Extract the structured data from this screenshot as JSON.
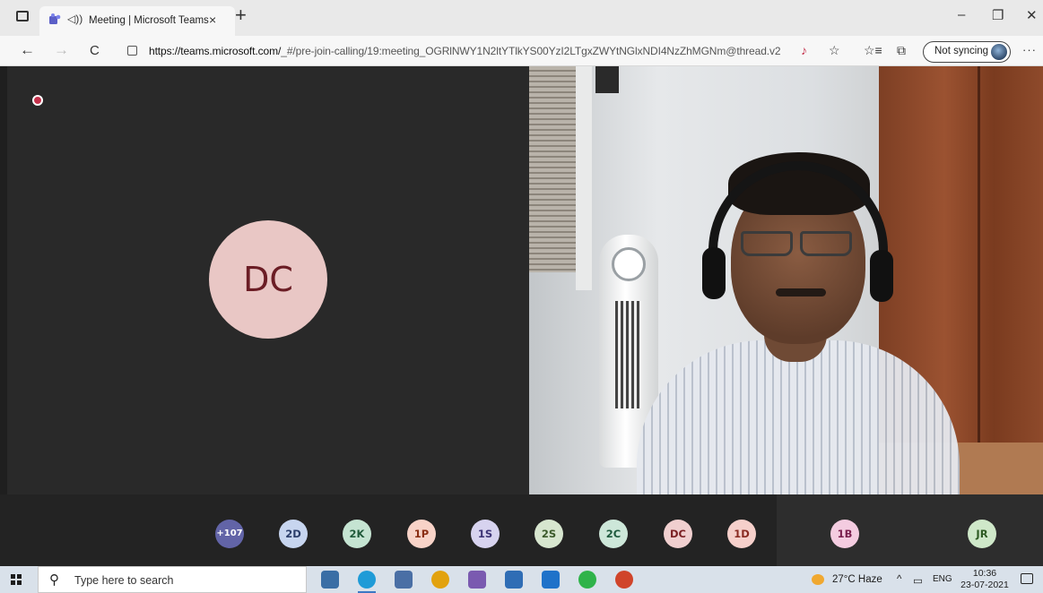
{
  "browser": {
    "tab_title": "Meeting | Microsoft Teams",
    "tab_audio_icon": "speaker-icon",
    "tab_close": "×",
    "new_tab": "+",
    "window_min": "–",
    "window_restore": "❐",
    "window_close": "✕",
    "back": "←",
    "forward": "→",
    "refresh": "C",
    "url_domain": "https://teams.microsoft.com/",
    "url_path": "_#/pre-join-calling/19:meeting_OGRlNWY1N2ltYTlkYS00YzI2LTgxZWYtNGlxNDI4NzZhMGNm@thread.v2",
    "sync_label": "Not syncing",
    "more": "···",
    "accent_color": "#0f6cbd"
  },
  "meeting": {
    "main_participant_initials": "DC",
    "main_avatar_color": "#e9c7c5",
    "recording_color": "#c4314b",
    "participants": [
      {
        "initials": "+107",
        "bg": "#6264a7",
        "fg": "#ffffff"
      },
      {
        "initials": "2D",
        "bg": "#c7d5ef",
        "fg": "#2b3e6b"
      },
      {
        "initials": "2K",
        "bg": "#c5e4d2",
        "fg": "#1f5a3a"
      },
      {
        "initials": "1P",
        "bg": "#f8d3c8",
        "fg": "#8a2d12"
      },
      {
        "initials": "1S",
        "bg": "#d7d3ef",
        "fg": "#3c3375"
      },
      {
        "initials": "2S",
        "bg": "#d7e6cf",
        "fg": "#3b5a2a"
      },
      {
        "initials": "2C",
        "bg": "#cde7d9",
        "fg": "#1e5a3d"
      },
      {
        "initials": "DC",
        "bg": "#f0cfcf",
        "fg": "#7a1f22"
      },
      {
        "initials": "1D",
        "bg": "#f6d0cb",
        "fg": "#8a2b22"
      },
      {
        "initials": "1B",
        "bg": "#f4cce0",
        "fg": "#7a1f4e"
      },
      {
        "initials": "JR",
        "bg": "#cfe8c9",
        "fg": "#2d5a22"
      }
    ]
  },
  "taskbar": {
    "search_placeholder": "Type here to search",
    "weather": "27°C  Haze",
    "language": "ENG",
    "time": "10:36",
    "date": "23-07-2021",
    "apps": [
      {
        "name": "task-view-icon",
        "color": "#3a6ea5"
      },
      {
        "name": "edge-icon",
        "color": "#1f9bd7"
      },
      {
        "name": "store-icon",
        "color": "#4a6fa5"
      },
      {
        "name": "chrome-icon",
        "color": "#e2a20f"
      },
      {
        "name": "game-icon",
        "color": "#7a5ab0"
      },
      {
        "name": "file-explorer-icon",
        "color": "#2f6db5"
      },
      {
        "name": "mail-icon",
        "color": "#1f72c9"
      },
      {
        "name": "whatsapp-icon",
        "color": "#2fb34a"
      },
      {
        "name": "powerpoint-icon",
        "color": "#d0442a"
      }
    ]
  }
}
